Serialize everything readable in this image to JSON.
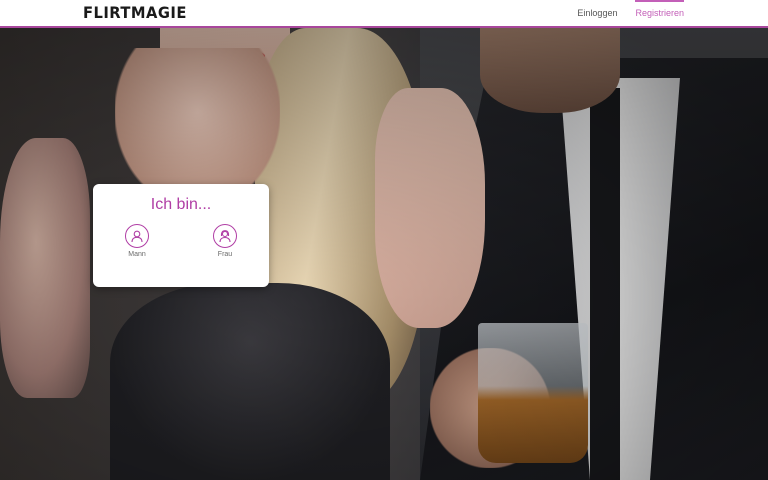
{
  "header": {
    "logo_text": "FLIRTMAGIE",
    "nav": {
      "login": "Einloggen",
      "register": "Registrieren"
    }
  },
  "gender_card": {
    "title": "Ich bin...",
    "options": [
      {
        "label": "Mann",
        "icon": "male-avatar-icon"
      },
      {
        "label": "Frau",
        "icon": "female-avatar-icon"
      }
    ]
  },
  "colors": {
    "accent": "#b03ea5",
    "header_bg": "#ffffff",
    "header_border": "#a8479c"
  }
}
